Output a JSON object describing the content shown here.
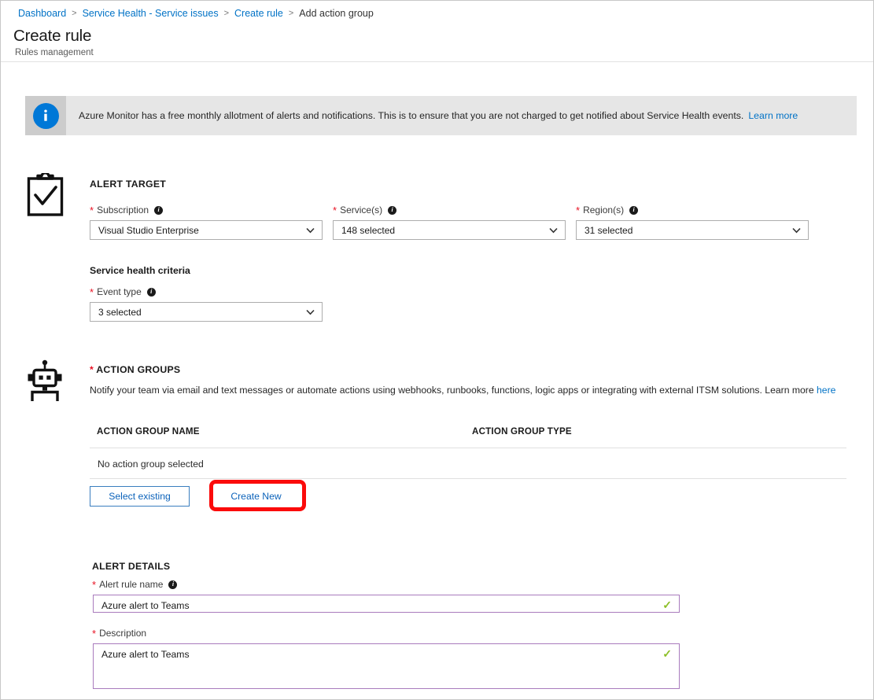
{
  "breadcrumb": {
    "items": [
      {
        "label": "Dashboard",
        "link": true
      },
      {
        "label": "Service Health - Service issues",
        "link": true
      },
      {
        "label": "Create rule",
        "link": true
      },
      {
        "label": "Add action group",
        "link": false
      }
    ],
    "separator": ">"
  },
  "header": {
    "title": "Create rule",
    "subtitle": "Rules management"
  },
  "banner": {
    "icon": "info-icon",
    "text": "Azure Monitor has a free monthly allotment of alerts and notifications. This is to ensure that you are not charged to get notified about Service Health events.",
    "link_label": "Learn more"
  },
  "alert_target": {
    "section_icon": "clipboard-check-icon",
    "heading": "ALERT TARGET",
    "fields": [
      {
        "label": "Subscription",
        "required": true,
        "has_info": true,
        "value": "Visual Studio Enterprise"
      },
      {
        "label": "Service(s)",
        "required": true,
        "has_info": true,
        "value": "148 selected"
      },
      {
        "label": "Region(s)",
        "required": true,
        "has_info": true,
        "value": "31 selected"
      }
    ],
    "criteria_heading": "Service health criteria",
    "event_type": {
      "label": "Event type",
      "required": true,
      "has_info": true,
      "value": "3 selected"
    }
  },
  "action_groups": {
    "section_icon": "robot-icon",
    "heading": "ACTION GROUPS",
    "required": true,
    "description": "Notify your team via email and text messages or automate actions using webhooks, runbooks, functions, logic apps or integrating with external ITSM solutions. Learn more",
    "description_link": "here",
    "table": {
      "columns": [
        "ACTION GROUP NAME",
        "ACTION GROUP TYPE"
      ],
      "empty_message": "No action group selected"
    },
    "buttons": {
      "select_existing": "Select existing",
      "create_new": "Create New"
    },
    "highlight_color": "#fb0b0b"
  },
  "alert_details": {
    "heading": "ALERT DETAILS",
    "rule_name": {
      "label": "Alert rule name",
      "required": true,
      "has_info": true,
      "value": "Azure alert to Teams",
      "valid": true
    },
    "description": {
      "label": "Description",
      "required": true,
      "has_info": false,
      "value": "Azure alert to Teams",
      "valid": true
    },
    "valid_mark": "✓"
  },
  "colors": {
    "link": "#0072c6",
    "required_star": "#e81123",
    "button_blue": "#0b62ba",
    "input_border": "#a97bbd",
    "check_green": "#8cbf26",
    "highlight_red": "#fb0b0b"
  }
}
